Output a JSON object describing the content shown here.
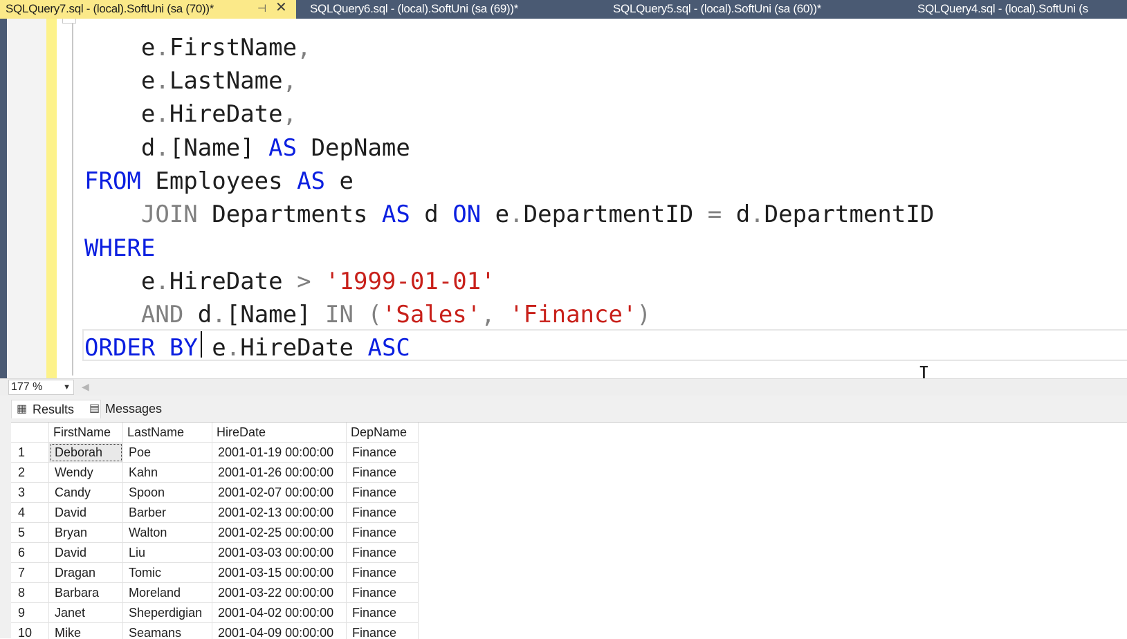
{
  "tabs": [
    {
      "label": "SQLQuery7.sql - (local).SoftUni (sa (70))*",
      "active": true
    },
    {
      "label": "SQLQuery6.sql - (local).SoftUni (sa (69))*",
      "active": false
    },
    {
      "label": "SQLQuery5.sql - (local).SoftUni (sa (60))*",
      "active": false
    },
    {
      "label": "SQLQuery4.sql - (local).SoftUni (s",
      "active": false
    }
  ],
  "tab_icons": {
    "pin": "pin-icon",
    "close": "close-icon"
  },
  "editor": {
    "lines": {
      "l1": {
        "a": "    e",
        "b": ".",
        "c": "FirstName",
        "d": ","
      },
      "l2": {
        "a": "    e",
        "b": ".",
        "c": "LastName",
        "d": ","
      },
      "l3": {
        "a": "    e",
        "b": ".",
        "c": "HireDate",
        "d": ","
      },
      "l4": {
        "a": "    d",
        "b": ".",
        "c": "[Name] ",
        "kw": "AS",
        "e": " DepName"
      },
      "l5": {
        "kw1": "FROM",
        "a": " Employees ",
        "kw2": "AS",
        "b": " e"
      },
      "l6": {
        "gr1": "    JOIN",
        "a": " Departments ",
        "kw1": "AS",
        "b": " d ",
        "kw2": "ON",
        "c": " e",
        "dot1": ".",
        "d": "DepartmentID ",
        "eq": "=",
        "e": " d",
        "dot2": ".",
        "f": "DepartmentID"
      },
      "l7": {
        "kw": "WHERE"
      },
      "l8": {
        "a": "    e",
        "dot": ".",
        "b": "HireDate ",
        "gt": ">",
        "sp": " ",
        "str": "'1999-01-01'"
      },
      "l9": {
        "gr1": "    AND",
        "sp": " ",
        "a": "d",
        "dot": ".",
        "b": "[Name] ",
        "gr2": "IN",
        "gr3": " (",
        "s1": "'Sales'",
        "comma": ", ",
        "s2": "'Finance'",
        "gr4": ")"
      },
      "l10": {
        "kw1": "ORDER",
        "sp1": " ",
        "kw2": "BY",
        "a": " e",
        "dot": ".",
        "b": "HireDate ",
        "kw3": "ASC"
      }
    }
  },
  "zoom": {
    "value": "177 %"
  },
  "results_tabs": {
    "results": "Results",
    "messages": "Messages"
  },
  "results_icons": {
    "results": "grid-icon",
    "messages": "messages-icon"
  },
  "grid": {
    "columns": [
      "",
      "FirstName",
      "LastName",
      "HireDate",
      "DepName"
    ],
    "rows": [
      [
        "1",
        "Deborah",
        "Poe",
        "2001-01-19 00:00:00",
        "Finance"
      ],
      [
        "2",
        "Wendy",
        "Kahn",
        "2001-01-26 00:00:00",
        "Finance"
      ],
      [
        "3",
        "Candy",
        "Spoon",
        "2001-02-07 00:00:00",
        "Finance"
      ],
      [
        "4",
        "David",
        "Barber",
        "2001-02-13 00:00:00",
        "Finance"
      ],
      [
        "5",
        "Bryan",
        "Walton",
        "2001-02-25 00:00:00",
        "Finance"
      ],
      [
        "6",
        "David",
        "Liu",
        "2001-03-03 00:00:00",
        "Finance"
      ],
      [
        "7",
        "Dragan",
        "Tomic",
        "2001-03-15 00:00:00",
        "Finance"
      ],
      [
        "8",
        "Barbara",
        "Moreland",
        "2001-03-22 00:00:00",
        "Finance"
      ],
      [
        "9",
        "Janet",
        "Sheperdigian",
        "2001-04-02 00:00:00",
        "Finance"
      ],
      [
        "10",
        "Mike",
        "Seamans",
        "2001-04-09 00:00:00",
        "Finance"
      ]
    ]
  }
}
